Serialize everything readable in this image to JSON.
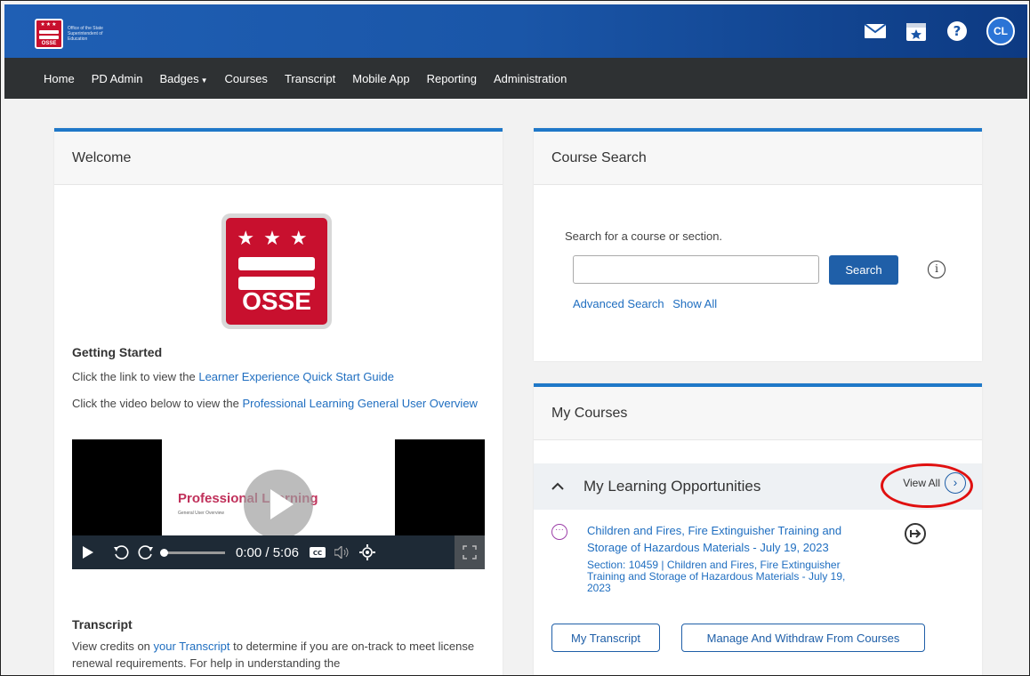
{
  "header": {
    "logo_text": "Office of the State Superintendent of Education",
    "logo_mark_text": "OSSE",
    "icons": [
      "mail-icon",
      "calendar-star-icon",
      "help-icon"
    ],
    "avatar_initials": "CL"
  },
  "nav": {
    "items": [
      {
        "label": "Home"
      },
      {
        "label": "PD Admin"
      },
      {
        "label": "Badges",
        "dropdown": true
      },
      {
        "label": "Courses"
      },
      {
        "label": "Transcript"
      },
      {
        "label": "Mobile App"
      },
      {
        "label": "Reporting"
      },
      {
        "label": "Administration"
      }
    ]
  },
  "welcome": {
    "title": "Welcome",
    "logo_text": "OSSE",
    "getting_started_heading": "Getting Started",
    "line1_prefix": "Click the link to view the ",
    "line1_link": "Learner Experience Quick Start Guide",
    "line2_prefix": "Click the video below to view the ",
    "line2_link": "Professional Learning General User Overview",
    "video": {
      "slide_title": "Professional Learning",
      "slide_subtitle": "General User Overview",
      "current_time": "0:00",
      "separator": "/",
      "duration": "5:06"
    },
    "transcript_heading": "Transcript",
    "transcript_prefix": "View credits on ",
    "transcript_link": "your Transcript",
    "transcript_suffix": " to determine if you are on-track to meet license renewal requirements. For help in understanding the"
  },
  "course_search": {
    "title": "Course Search",
    "label": "Search for a course or section.",
    "input_value": "",
    "search_button": "Search",
    "advanced_link": "Advanced Search",
    "show_all_link": "Show All"
  },
  "my_courses": {
    "title": "My Courses",
    "section_title": "My Learning Opportunities",
    "view_all": "View All",
    "course": {
      "title": "Children and Fires, Fire Extinguisher Training and Storage of Hazardous Materials - July 19, 2023",
      "section": "Section: 10459 | Children and Fires, Fire Extinguisher Training and Storage of Hazardous Materials - July 19, 2023"
    },
    "my_transcript_button": "My Transcript",
    "manage_button": "Manage And Withdraw From Courses"
  },
  "colors": {
    "header_blue": "#1a56a8",
    "nav_dark": "#2e3133",
    "card_accent": "#1f78c8",
    "link_blue": "#1f6ec0",
    "osse_red": "#c8102e",
    "highlight_ring": "#e01010"
  }
}
